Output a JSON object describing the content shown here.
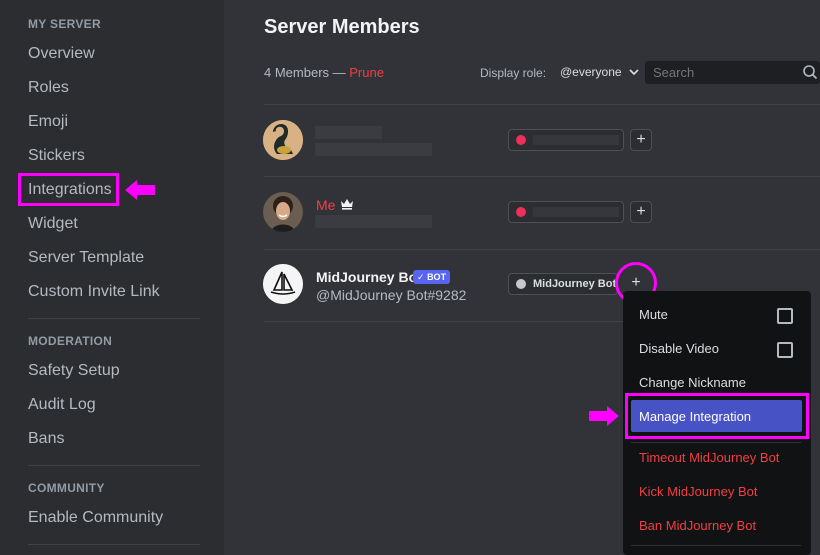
{
  "sidebar": {
    "section_my_server": "MY SERVER",
    "items_my_server": [
      "Overview",
      "Roles",
      "Emoji",
      "Stickers",
      "Integrations",
      "Widget",
      "Server Template",
      "Custom Invite Link"
    ],
    "section_moderation": "MODERATION",
    "items_moderation": [
      "Safety Setup",
      "Audit Log",
      "Bans"
    ],
    "section_community": "COMMUNITY",
    "items_community": [
      "Enable Community"
    ]
  },
  "main": {
    "title": "Server Members",
    "members_count": "4 Members —",
    "prune_label": "Prune",
    "display_role_label": "Display role:",
    "display_role_value": "@everyone",
    "search_placeholder": "Search"
  },
  "members": [
    {
      "name": "",
      "role_color": "#ed2f5c"
    },
    {
      "name": "Me",
      "role_color": "#ed2f5c",
      "name_color": "#f23f42",
      "owner_icon": "crown-icon"
    },
    {
      "name": "MidJourney Bot",
      "tag": "BOT",
      "tag_verified_icon": "check-icon",
      "subtitle": "@MidJourney Bot#9282",
      "role_name": "MidJourney Bot",
      "role_color": "#c4c9ce"
    }
  ],
  "context_menu": {
    "mute": "Mute",
    "disable_video": "Disable Video",
    "change_nickname": "Change Nickname",
    "manage_integration": "Manage Integration",
    "timeout": "Timeout MidJourney Bot",
    "kick": "Kick MidJourney Bot",
    "ban": "Ban MidJourney Bot"
  },
  "colors": {
    "highlight": "#ff00ff",
    "accent": "#5865f2",
    "danger": "#f23f42"
  }
}
